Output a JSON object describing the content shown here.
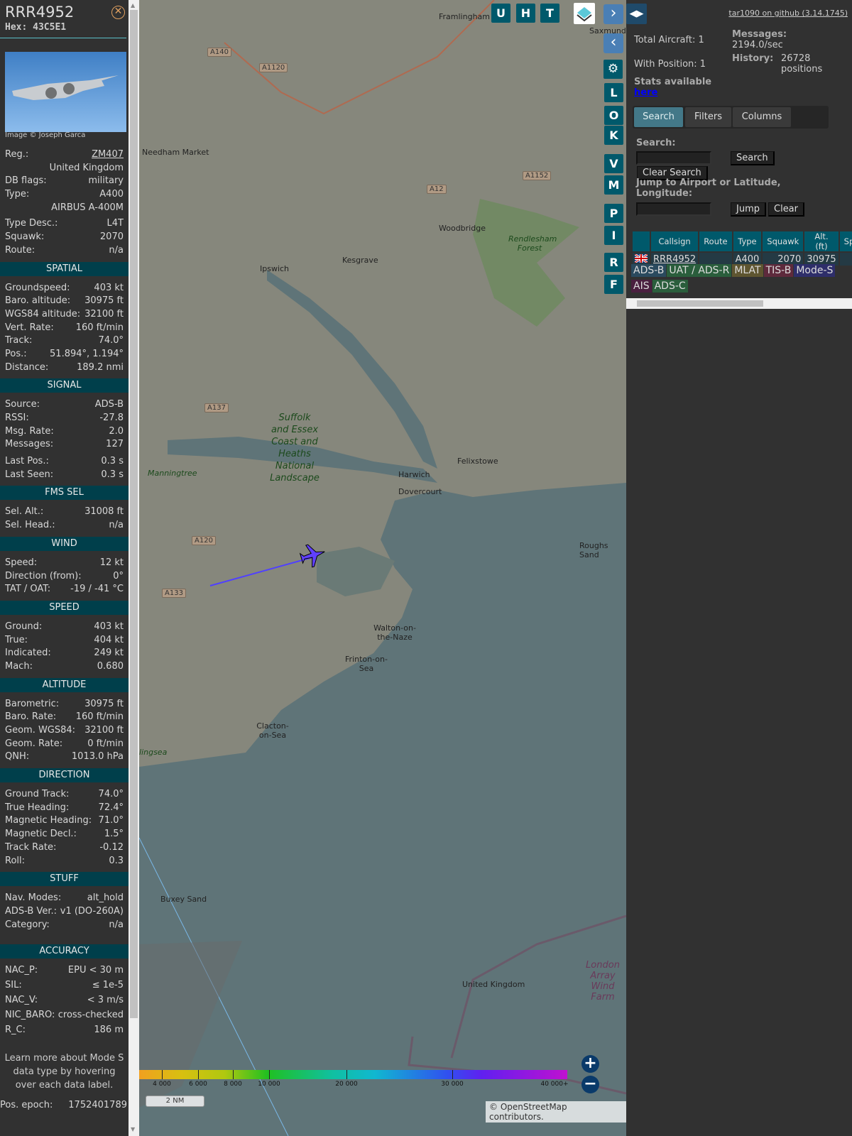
{
  "detail": {
    "callsign": "RRR4952",
    "hex": "Hex: 43C5E1",
    "photo_credit": "Image © Joseph Garca",
    "info": [
      {
        "k": "Reg.:",
        "v": "ZM407",
        "link": true
      },
      {
        "k": "",
        "v": "United Kingdom"
      },
      {
        "k": "DB flags:",
        "v": "military"
      },
      {
        "k": "Type:",
        "v": "A400"
      },
      {
        "k": "",
        "v": "AIRBUS A-400M"
      },
      {
        "k": "Type Desc.:",
        "v": "L4T",
        "gap": true
      },
      {
        "k": "Squawk:",
        "v": "2070"
      },
      {
        "k": "Route:",
        "v": "n/a"
      }
    ],
    "sections": [
      {
        "title": "SPATIAL",
        "rows": [
          [
            "Groundspeed:",
            "403 kt"
          ],
          [
            "Baro. altitude:",
            "30975 ft"
          ],
          [
            "WGS84 altitude:",
            "32100 ft"
          ],
          [
            "Vert. Rate:",
            "160 ft/min"
          ],
          [
            "Track:",
            "74.0°"
          ],
          [
            "Pos.:",
            "51.894°, 1.194°"
          ],
          [
            "Distance:",
            "189.2 nmi"
          ]
        ]
      },
      {
        "title": "SIGNAL",
        "rows": [
          [
            "Source:",
            "ADS-B"
          ],
          [
            "RSSI:",
            "-27.8"
          ],
          [
            "Msg. Rate:",
            "2.0"
          ],
          [
            "Messages:",
            "127"
          ],
          [
            "Last Pos.:",
            "0.3 s"
          ],
          [
            "Last Seen:",
            "0.3 s"
          ]
        ]
      },
      {
        "title": "FMS SEL",
        "rows": [
          [
            "Sel. Alt.:",
            "31008 ft"
          ],
          [
            "Sel. Head.:",
            "n/a"
          ]
        ]
      },
      {
        "title": "WIND",
        "rows": [
          [
            "Speed:",
            "12 kt"
          ],
          [
            "Direction (from):",
            "0°"
          ],
          [
            "TAT / OAT:",
            "-19 / -41 °C"
          ]
        ]
      },
      {
        "title": "SPEED",
        "rows": [
          [
            "Ground:",
            "403 kt"
          ],
          [
            "True:",
            "404 kt"
          ],
          [
            "Indicated:",
            "249 kt"
          ],
          [
            "Mach:",
            "0.680"
          ]
        ]
      },
      {
        "title": "ALTITUDE",
        "rows": [
          [
            "Barometric:",
            "30975 ft"
          ],
          [
            "Baro. Rate:",
            "160 ft/min"
          ],
          [
            "Geom. WGS84:",
            "32100 ft"
          ],
          [
            "Geom. Rate:",
            "0 ft/min"
          ],
          [
            "QNH:",
            "1013.0 hPa"
          ]
        ]
      },
      {
        "title": "DIRECTION",
        "rows": [
          [
            "Ground Track:",
            "74.0°"
          ],
          [
            "True Heading:",
            "72.4°"
          ],
          [
            "Magnetic Heading:",
            "71.0°"
          ],
          [
            "Magnetic Decl.:",
            "1.5°"
          ],
          [
            "Track Rate:",
            "-0.12"
          ],
          [
            "Roll:",
            "0.3"
          ]
        ]
      },
      {
        "title": "STUFF",
        "rows": [
          [
            "Nav. Modes:",
            "alt_hold"
          ],
          [
            "ADS-B Ver.:",
            "v1 (DO-260A)"
          ],
          [
            "Category:",
            "n/a"
          ]
        ]
      },
      {
        "title": "ACCURACY",
        "rows": [
          [
            "NAC_P:",
            "EPU < 30 m"
          ],
          [
            "SIL:",
            "≤ 1e-5"
          ],
          [
            "NAC_V:",
            "< 3 m/s"
          ],
          [
            "NIC_BARO:",
            "cross-checked"
          ],
          [
            "R_C:",
            "186 m"
          ]
        ]
      }
    ],
    "learn_more": "Learn more about Mode S data type by hovering over each data label.",
    "pos_epoch_label": "Pos. epoch:",
    "pos_epoch": "1752401789"
  },
  "map": {
    "top_buttons": [
      "U",
      "H",
      "T"
    ],
    "side_buttons": [
      "L",
      "O",
      "K",
      "V",
      "M",
      "P",
      "I",
      "R",
      "F"
    ],
    "places": [
      "Framlingham",
      "Saxmundham",
      "Needham Market",
      "Woodbridge",
      "Rendlesham Forest",
      "Ipswich",
      "Kesgrave",
      "Suffolk and Essex Coast and Heaths National Landscape",
      "Felixstowe",
      "Harwich",
      "Dovercourt",
      "Manningtree",
      "Roughs Sand",
      "Walton-on-the-Naze",
      "Frinton-on-Sea",
      "Clacton-on-Sea",
      "lingsea",
      "Buxey Sand",
      "London Array Wind Farm",
      "United Kingdom"
    ],
    "roads": [
      "A140",
      "A1120",
      "A12",
      "A1152",
      "A137",
      "A120",
      "A133"
    ],
    "altitude_legend": [
      "4 000",
      "6 000",
      "8 000",
      "10 000",
      "20 000",
      "30 000",
      "40 000+"
    ],
    "scale": "2 NM",
    "attribution": "© OpenStreetMap contributors."
  },
  "right": {
    "github": "tar1090 on github (3.14.1745)",
    "total_aircraft": "Total Aircraft: 1",
    "with_position": "With Position: 1",
    "messages_label": "Messages:",
    "messages": "2194.0/sec",
    "history_label": "History:",
    "history": "26728 positions",
    "stats": "Stats available",
    "stats_link": "here",
    "tabs": [
      "Search",
      "Filters",
      "Columns"
    ],
    "search_label": "Search:",
    "search_btn": "Search",
    "clear_search": "Clear Search",
    "jump_label": "Jump to Airport or Latitude, Longitude:",
    "jump_btn": "Jump",
    "clear_btn": "Clear",
    "columns": [
      "",
      "Callsign",
      "Route",
      "Type",
      "Squawk",
      "Alt. (ft)",
      "Spd"
    ],
    "rows": [
      {
        "callsign": "RRR4952",
        "route": "",
        "type": "A400",
        "squawk": "2070",
        "alt": "30975",
        "spd": ""
      }
    ],
    "sources": [
      {
        "l": "ADS-B",
        "c": "#2a4a5e"
      },
      {
        "l": "UAT / ADS-R",
        "c": "#2a5e3c"
      },
      {
        "l": "MLAT",
        "c": "#5e5530"
      },
      {
        "l": "TIS-B",
        "c": "#5e2a3c"
      },
      {
        "l": "Mode-S",
        "c": "#2e2e6a"
      },
      {
        "l": "AIS",
        "c": "#4a2040"
      },
      {
        "l": "ADS-C",
        "c": "#2a5e3c"
      }
    ]
  }
}
